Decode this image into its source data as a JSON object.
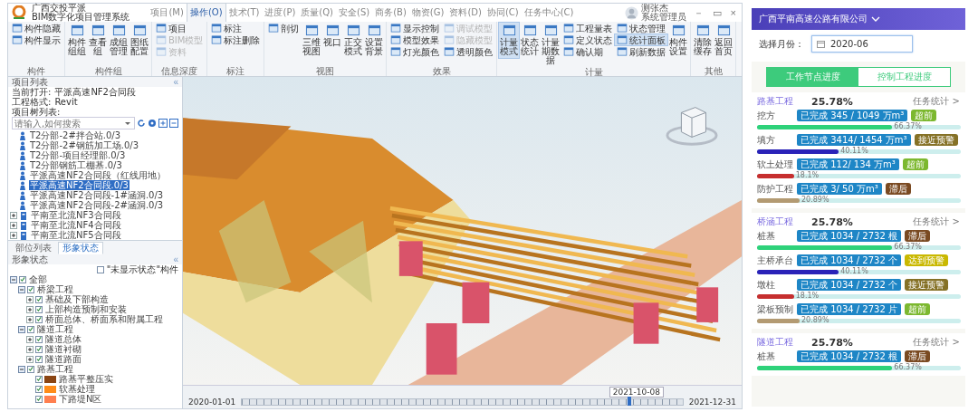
{
  "app": {
    "title_line1": "广西交投平派",
    "title_line2": "BIM数字化项目管理系统"
  },
  "menu": [
    {
      "label": "项目(M)",
      "selected": false
    },
    {
      "label": "操作(O)",
      "selected": true
    },
    {
      "label": "技术(T)",
      "selected": false
    },
    {
      "label": "进度(P)",
      "selected": false
    },
    {
      "label": "质量(Q)",
      "selected": false
    },
    {
      "label": "安全(S)",
      "selected": false
    },
    {
      "label": "商务(B)",
      "selected": false
    },
    {
      "label": "物资(G)",
      "selected": false
    },
    {
      "label": "资料(D)",
      "selected": false
    },
    {
      "label": "协同(C)",
      "selected": false
    },
    {
      "label": "任务中心(C)",
      "selected": false
    }
  ],
  "user": {
    "name": "测张杰",
    "role": "系统管理员"
  },
  "window_controls": [
    "－",
    "▭",
    "×"
  ],
  "ribbon": [
    {
      "label": "构件",
      "items": [
        {
          "label": "构件隐藏",
          "kind": "small",
          "selected": false,
          "disabled": false
        },
        {
          "label": "构件显示",
          "kind": "small",
          "selected": false,
          "disabled": false
        }
      ]
    },
    {
      "label": "构件组",
      "items": [
        {
          "label": "构件组组",
          "kind": "large",
          "selected": false,
          "disabled": false
        },
        {
          "label": "查看组",
          "kind": "large",
          "selected": false,
          "disabled": false
        },
        {
          "label": "成组管理",
          "kind": "large",
          "selected": false,
          "disabled": false
        },
        {
          "label": "图纸配置",
          "kind": "large",
          "selected": false,
          "disabled": false
        }
      ]
    },
    {
      "label": "信息深度",
      "items": [
        {
          "label": "项目",
          "kind": "small",
          "selected": false,
          "disabled": false
        },
        {
          "label": "BIM模型",
          "kind": "small",
          "selected": false,
          "disabled": true
        },
        {
          "label": "资料",
          "kind": "small",
          "selected": false,
          "disabled": true
        }
      ]
    },
    {
      "label": "标注",
      "items": [
        {
          "label": "标注",
          "kind": "small",
          "selected": false,
          "disabled": false
        },
        {
          "label": "标注删除",
          "kind": "small",
          "selected": false,
          "disabled": false
        }
      ]
    },
    {
      "label": "视图",
      "items": [
        {
          "label": "剖切",
          "kind": "small",
          "selected": false,
          "disabled": false
        },
        {
          "label": "三维视图",
          "kind": "large",
          "selected": false,
          "disabled": false
        },
        {
          "label": "视口",
          "kind": "large",
          "selected": false,
          "disabled": false
        },
        {
          "label": "正交模式",
          "kind": "large",
          "selected": false,
          "disabled": false
        },
        {
          "label": "设置背景",
          "kind": "large",
          "selected": false,
          "disabled": false
        }
      ]
    },
    {
      "label": "效果",
      "items": [
        {
          "label": "显示控制",
          "kind": "small",
          "selected": false,
          "disabled": false
        },
        {
          "label": "模型效果",
          "kind": "small",
          "selected": false,
          "disabled": false
        },
        {
          "label": "灯光颜色",
          "kind": "small",
          "selected": false,
          "disabled": false
        },
        {
          "label": "调试模型",
          "kind": "small",
          "selected": false,
          "disabled": true
        },
        {
          "label": "隐藏模型",
          "kind": "small",
          "selected": false,
          "disabled": true
        },
        {
          "label": "透明颜色",
          "kind": "small",
          "selected": false,
          "disabled": false
        }
      ]
    },
    {
      "label": "计量",
      "items": [
        {
          "label": "计量模式",
          "kind": "large",
          "selected": true,
          "disabled": false
        },
        {
          "label": "状态统计",
          "kind": "large",
          "selected": false,
          "disabled": false
        },
        {
          "label": "计量期数据",
          "kind": "large",
          "selected": false,
          "disabled": false
        },
        {
          "label": "工程量表",
          "kind": "small",
          "selected": false,
          "disabled": false
        },
        {
          "label": "定义状态",
          "kind": "small",
          "selected": false,
          "disabled": false
        },
        {
          "label": "确认期",
          "kind": "small",
          "selected": false,
          "disabled": false
        },
        {
          "label": "状态管理",
          "kind": "small",
          "selected": false,
          "disabled": false
        },
        {
          "label": "统计面板",
          "kind": "small",
          "selected": true,
          "disabled": false
        },
        {
          "label": "刷新数据",
          "kind": "small",
          "selected": false,
          "disabled": false
        },
        {
          "label": "构件设置",
          "kind": "large",
          "selected": false,
          "disabled": false
        }
      ]
    },
    {
      "label": "其他",
      "items": [
        {
          "label": "清除缓存",
          "kind": "large",
          "selected": false,
          "disabled": false
        },
        {
          "label": "返回首页",
          "kind": "large",
          "selected": false,
          "disabled": false
        }
      ]
    }
  ],
  "project_panel": {
    "title": "项目列表",
    "collapse": "«",
    "fields": [
      {
        "label": "当前打开:",
        "value": "平派高速NF2合同段"
      },
      {
        "label": "工程格式:",
        "value": "Revit"
      },
      {
        "label": "项目树列表:"
      }
    ],
    "search": {
      "placeholder": "请输入,如何搜索"
    },
    "tree": [
      {
        "children": [
          {
            "label": "T2分部-2#拌合站.0/3",
            "selected": false
          },
          {
            "label": "T2分部-2#钢筋加工场.0/3",
            "selected": false
          },
          {
            "label": "T2分部-项目经理部.0/3",
            "selected": false
          },
          {
            "label": "T2分部钢筋工棚基.0/3",
            "selected": false
          },
          {
            "label": "平派高速NF2合同段（红线用地）",
            "selected": false
          },
          {
            "label": "平派高速NF2合同段.0/3",
            "selected": true
          },
          {
            "label": "平派高速NF2合同段-1#涵洞.0/3",
            "selected": false
          },
          {
            "label": "平派高速NF2合同段-2#涵洞.0/3",
            "selected": false
          }
        ]
      },
      {
        "label": "平南至北流NF3合同段",
        "expanded": false,
        "selected": false
      },
      {
        "label": "平南至北流NF4合同段",
        "expanded": false,
        "selected": false
      },
      {
        "label": "平南至北流NF5合同段",
        "expanded": false,
        "selected": false
      }
    ]
  },
  "tabs": [
    {
      "label": "部位列表",
      "selected": false
    },
    {
      "label": "形象状态",
      "selected": true
    }
  ],
  "status_panel": {
    "title": "形象状态",
    "collapse": "«",
    "filter": {
      "label": "\"未显示状态\"构件",
      "checked": false
    },
    "tree": [
      {
        "label": "全部",
        "checked": true,
        "expanded": true,
        "children": [
          {
            "label": "桥梁工程",
            "checked": true,
            "expanded": true,
            "children": [
              {
                "label": "基础及下部构造",
                "checked": true,
                "expanded": false
              },
              {
                "label": "上部构造预制和安装",
                "checked": true,
                "expanded": false
              },
              {
                "label": "桥面总体、桥面系和附属工程",
                "checked": true,
                "expanded": false
              }
            ]
          },
          {
            "label": "隧道工程",
            "checked": true,
            "expanded": true,
            "children": [
              {
                "label": "隧道总体",
                "checked": true,
                "expanded": false
              },
              {
                "label": "隧道衬砌",
                "checked": true,
                "expanded": false
              },
              {
                "label": "隧道路面",
                "checked": true,
                "expanded": false
              }
            ]
          },
          {
            "label": "路基工程",
            "checked": true,
            "expanded": true,
            "children": [
              {
                "label": "路基平整压实",
                "checked": true,
                "color": "#8b4513"
              },
              {
                "label": "软基处理",
                "checked": true,
                "color": "#ff8c1a"
              },
              {
                "label": "下路堤N区",
                "checked": true,
                "color": "#ff7f50"
              }
            ]
          }
        ]
      }
    ]
  },
  "timeline": {
    "start": "2020-01-01",
    "current": "2021-10-08",
    "end": "2021-12-31",
    "level": 0.88
  },
  "mobile": {
    "company": "广西平南高速公路有限公司",
    "month": {
      "label": "选择月份：",
      "value": "2020-06"
    },
    "tabs": [
      {
        "label": "工作节点进度",
        "selected": true
      },
      {
        "label": "控制工程进度",
        "selected": false
      }
    ],
    "sections": [
      {
        "title": "路基工程",
        "percent": "25.78%",
        "link": "任务统计 >",
        "items": [
          {
            "name": "挖方",
            "completed": "已完成 345 / 1049 万m³",
            "badge": {
              "label": "超前",
              "color": "#7cb82f"
            },
            "color": "#2ed27a",
            "level": 0.6637,
            "reading": "66.37%"
          },
          {
            "name": "填方",
            "completed": "已完成 3414/ 1454 万m³",
            "badge": {
              "label": "接近预警",
              "color": "#857126"
            },
            "color": "#2a22b8",
            "level": 0.4011,
            "reading": "40.11%"
          },
          {
            "name": "软土处理",
            "completed": "已完成 112/ 134 万m³",
            "badge": {
              "label": "超前",
              "color": "#7cb82f"
            },
            "color": "#c62f2f",
            "level": 0.181,
            "reading": "18.1%"
          },
          {
            "name": "防护工程",
            "completed": "已完成 3/ 50 万m³",
            "badge": {
              "label": "滞后",
              "color": "#7a4a22"
            },
            "color": "#b39a72",
            "level": 0.2089,
            "reading": "20.89%"
          }
        ]
      },
      {
        "title": "桥涵工程",
        "percent": "25.78%",
        "link": "任务统计 >",
        "items": [
          {
            "name": "桩基",
            "completed": "已完成 1034 / 2732 根",
            "badge": {
              "label": "滞后",
              "color": "#7a4a22"
            },
            "color": "#2ed27a",
            "level": 0.6637,
            "reading": "66.37%"
          },
          {
            "name": "主桥承台",
            "completed": "已完成 1034 / 2732 个",
            "badge": {
              "label": "达到预警",
              "color": "#c9b800"
            },
            "color": "#2a22b8",
            "level": 0.4011,
            "reading": "40.11%"
          },
          {
            "name": "墩柱",
            "completed": "已完成 1034 / 2732 个",
            "badge": {
              "label": "接近预警",
              "color": "#857126"
            },
            "color": "#c62f2f",
            "level": 0.181,
            "reading": "18.1%"
          },
          {
            "name": "梁板预制",
            "completed": "已完成 1034 / 2732 片",
            "badge": {
              "label": "超前",
              "color": "#7cb82f"
            },
            "color": "#b39a72",
            "level": 0.2089,
            "reading": "20.89%"
          }
        ]
      },
      {
        "title": "隧道工程",
        "percent": "25.78%",
        "link": "任务统计 >",
        "items": [
          {
            "name": "桩基",
            "completed": "已完成 1034 / 2732 根",
            "badge": {
              "label": "滞后",
              "color": "#7a4a22"
            },
            "color": "#2ed27a",
            "level": 0.6637,
            "reading": "66.37%"
          }
        ]
      }
    ]
  }
}
